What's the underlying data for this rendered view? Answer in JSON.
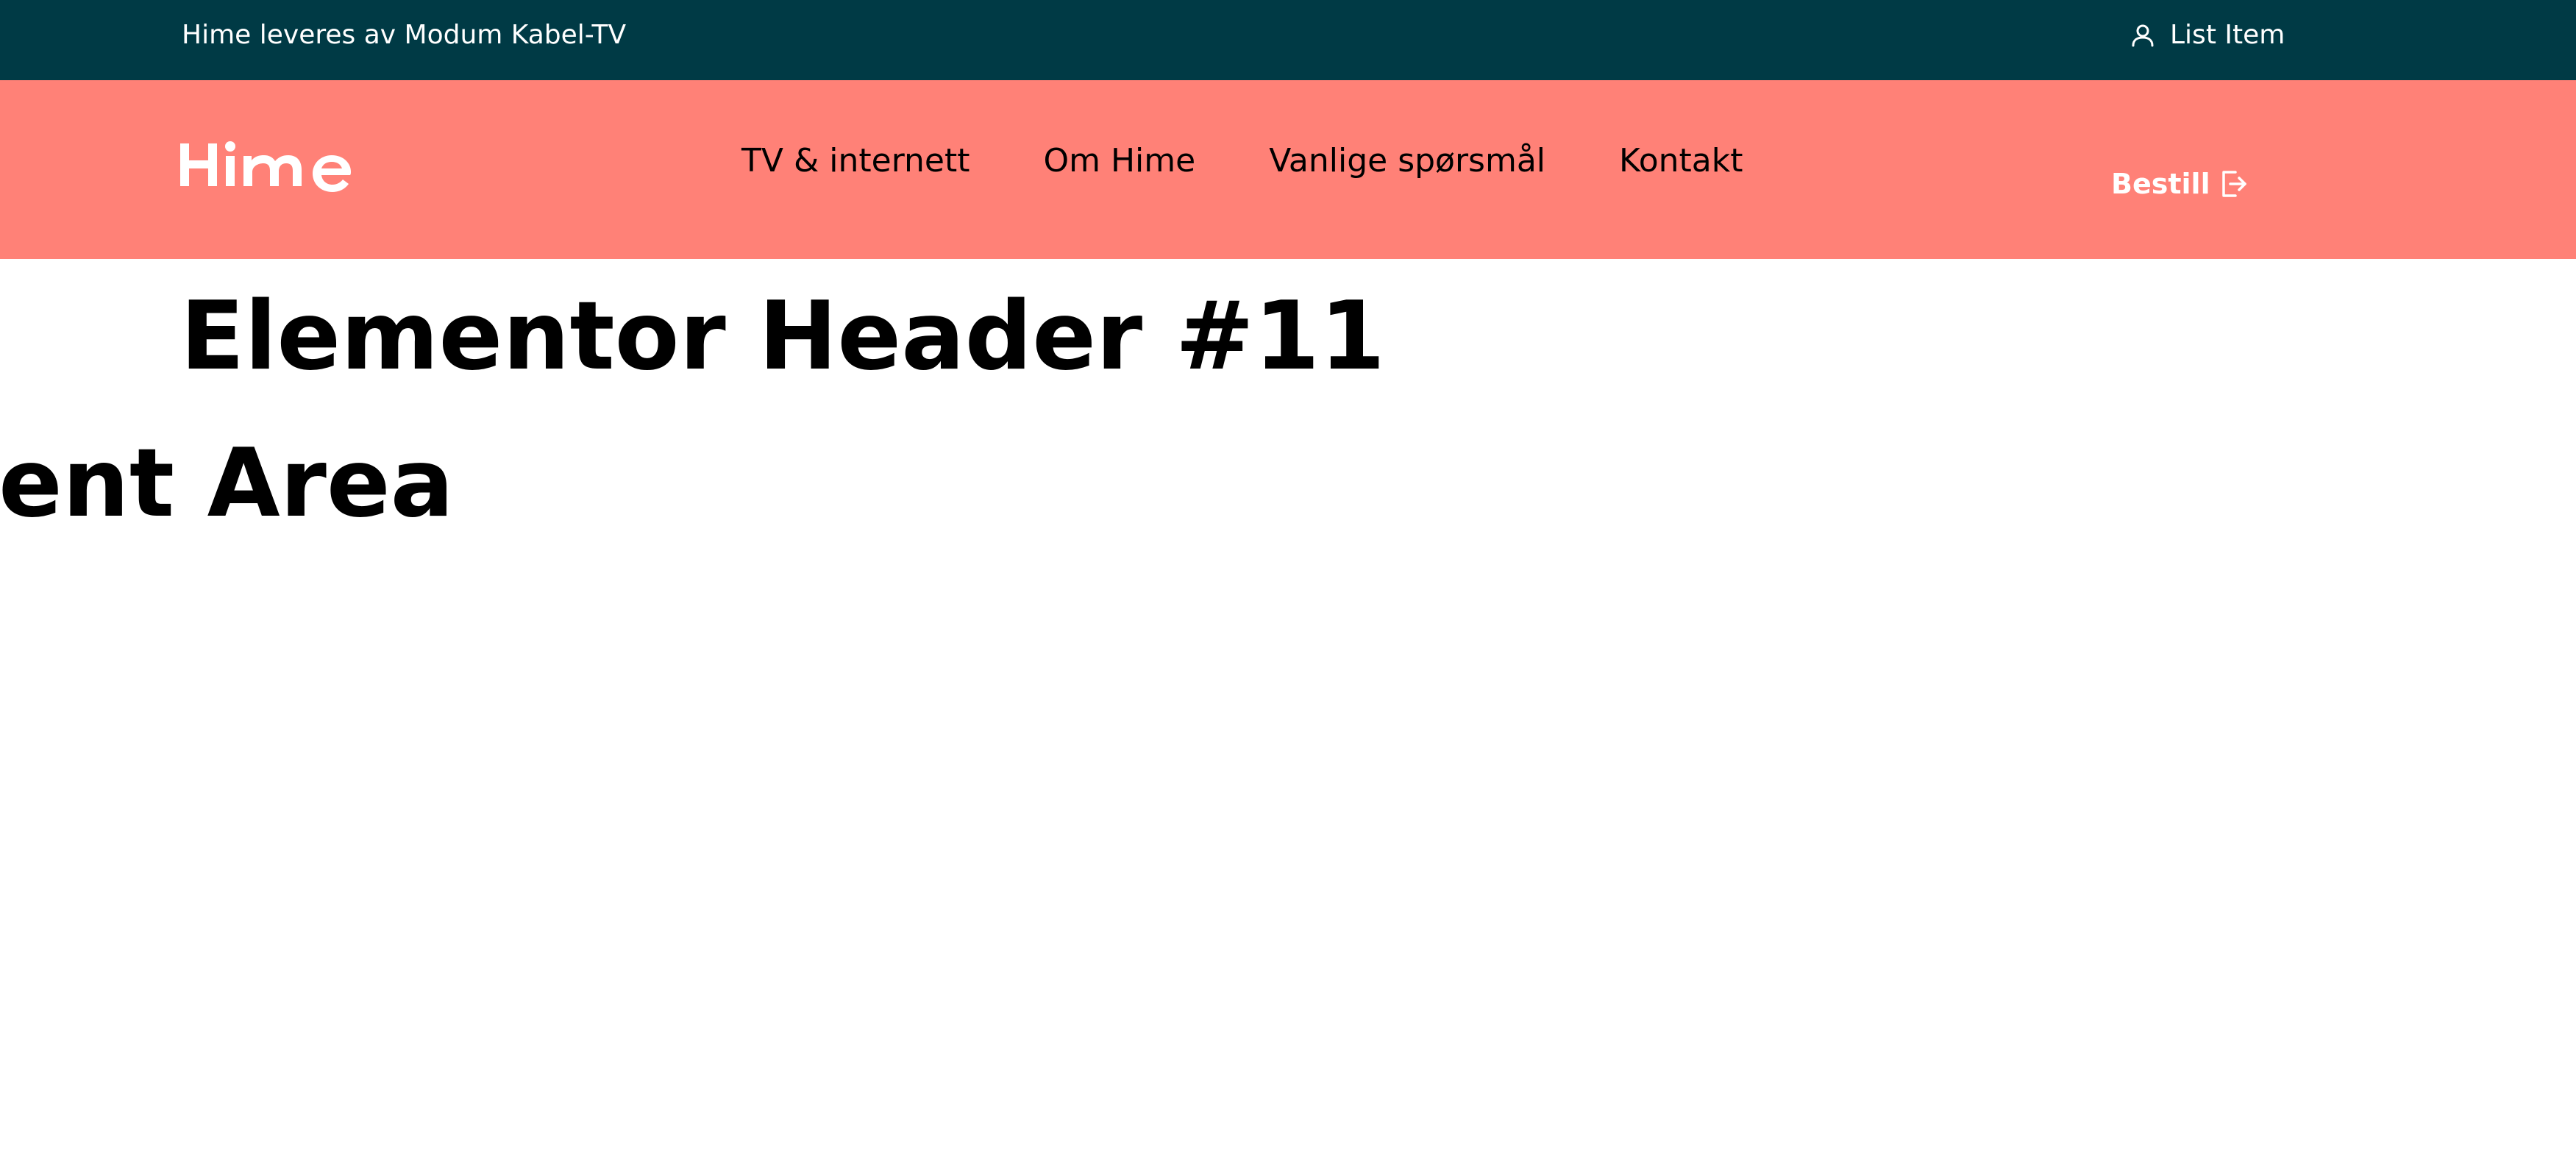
{
  "top_bar": {
    "notice": "Hime leveres av Modum Kabel-TV",
    "account_label": "List Item",
    "background_color": "#003a45",
    "icon": "user-icon"
  },
  "header": {
    "logo_text": "Hime",
    "background_color": "#ff8177",
    "nav_items": [
      "TV & internett",
      "Om Hime",
      "Vanlige spørsmål",
      "Kontakt"
    ],
    "order_button": {
      "label": "Bestill",
      "icon": "sign-out-icon"
    }
  },
  "main": {
    "heading": "Elementor Header #11",
    "content_heading_visible": "ntent Area"
  }
}
